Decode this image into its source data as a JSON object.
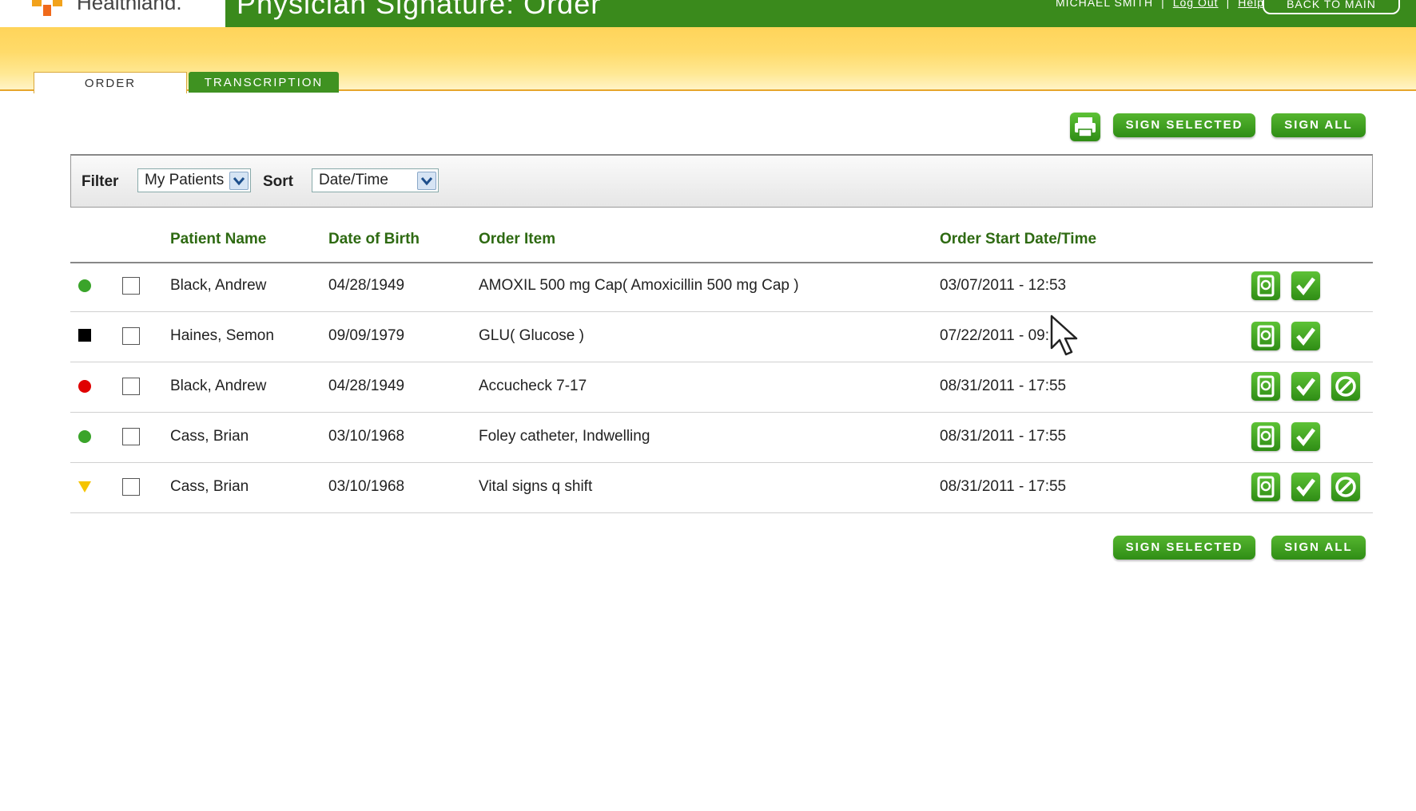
{
  "header": {
    "logo_text": "Healthland.",
    "title": "Physician Signature: Order",
    "user_name": "MICHAEL SMITH",
    "logout_label": "Log Out",
    "help_label": "Help",
    "back_label": "BACK TO MAIN"
  },
  "tabs": [
    {
      "label": "ORDER",
      "active": true
    },
    {
      "label": "TRANSCRIPTION",
      "active": false
    }
  ],
  "toolbar": {
    "sign_selected_label": "SIGN SELECTED",
    "sign_all_label": "SIGN ALL",
    "print_icon": "printer-icon"
  },
  "filter": {
    "filter_label": "Filter",
    "filter_value": "My Patients",
    "sort_label": "Sort",
    "sort_value": "Date/Time"
  },
  "table": {
    "columns": [
      "Patient Name",
      "Date of Birth",
      "Order Item",
      "Order Start Date/Time"
    ],
    "rows": [
      {
        "status": "green-circle",
        "patient": "Black, Andrew",
        "dob": "04/28/1949",
        "item": "AMOXIL 500 mg Cap( Amoxicillin 500 mg Cap )",
        "start": "03/07/2011 - 12:53",
        "cancel": false
      },
      {
        "status": "black-square",
        "patient": "Haines, Semon",
        "dob": "09/09/1979",
        "item": "GLU( Glucose )",
        "start": "07/22/2011 - 09:",
        "cancel": false
      },
      {
        "status": "red-circle",
        "patient": "Black, Andrew",
        "dob": "04/28/1949",
        "item": "Accucheck 7-17",
        "start": "08/31/2011 - 17:55",
        "cancel": true
      },
      {
        "status": "green-circle",
        "patient": "Cass, Brian",
        "dob": "03/10/1968",
        "item": "Foley catheter, Indwelling",
        "start": "08/31/2011 - 17:55",
        "cancel": false
      },
      {
        "status": "yellow-triangle",
        "patient": "Cass, Brian",
        "dob": "03/10/1968",
        "item": "Vital signs q shift",
        "start": "08/31/2011 - 17:55",
        "cancel": true
      }
    ]
  },
  "colors": {
    "header_green": "#3a8a1c",
    "button_green": "#3f9e1f",
    "heading_green": "#2e6a12",
    "band_yellow": "#ffd45a"
  }
}
